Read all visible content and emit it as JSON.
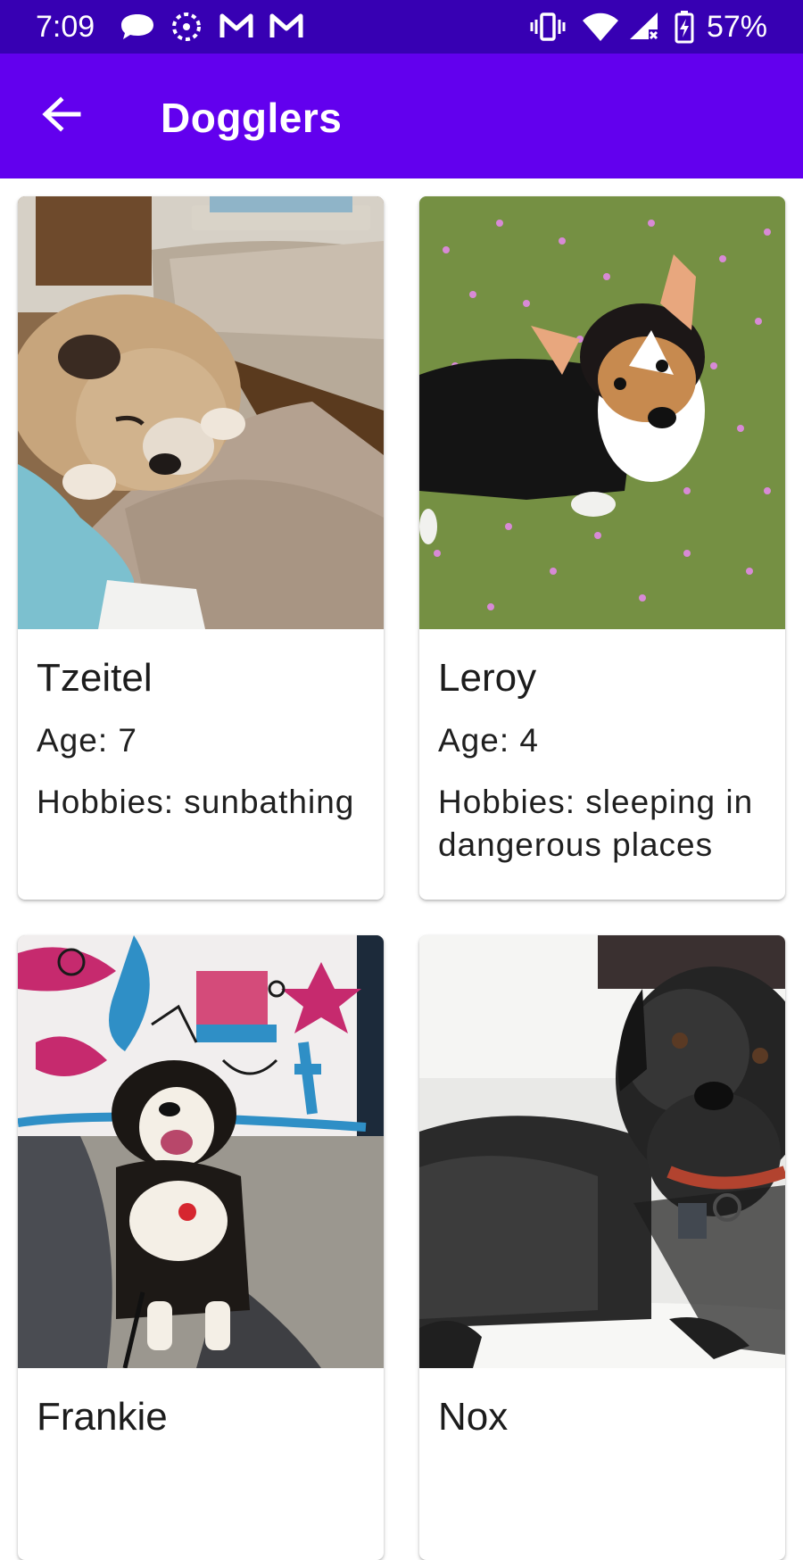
{
  "status_bar": {
    "time": "7:09",
    "battery_percent": "57%",
    "notification_icons": [
      "chat-bubble-icon",
      "sync-ring-icon",
      "gmail-icon",
      "gmail-icon"
    ],
    "system_icons": [
      "vibrate-icon",
      "wifi-icon",
      "cell-signal-icon",
      "battery-charging-icon"
    ],
    "background_color": "#3700b3"
  },
  "app_bar": {
    "title": "Dogglers",
    "back_icon": "arrow-back-icon",
    "background_color": "#6200ee"
  },
  "dogs": [
    {
      "name": "Tzeitel",
      "age": "Age: 7",
      "hobbies": "Hobbies: sunbathing"
    },
    {
      "name": "Leroy",
      "age": "Age: 4",
      "hobbies": "Hobbies: sleeping in dangerous places"
    },
    {
      "name": "Frankie",
      "age": "",
      "hobbies": ""
    },
    {
      "name": "Nox",
      "age": "",
      "hobbies": ""
    }
  ]
}
